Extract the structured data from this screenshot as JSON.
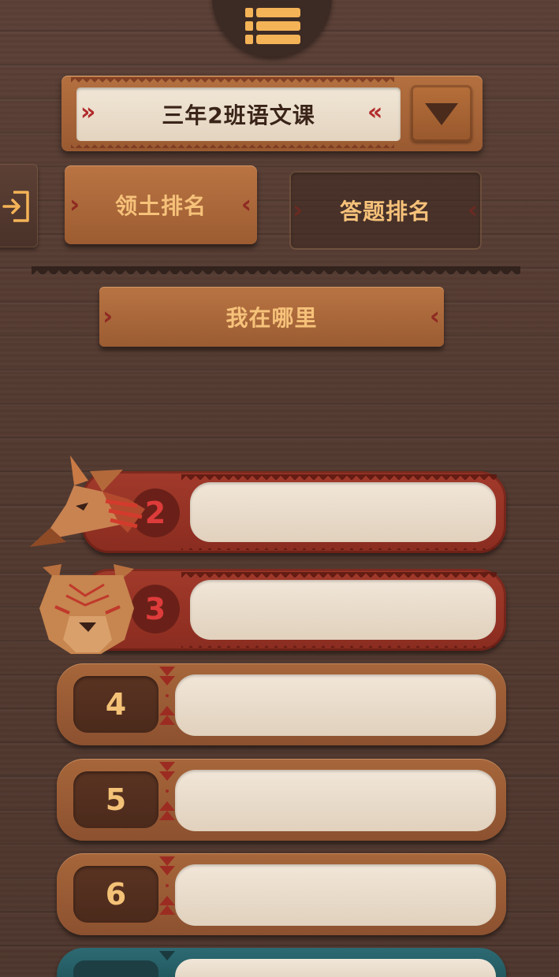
{
  "top_menu": {
    "icon": "menu-list-icon"
  },
  "class_selector": {
    "selected": "三年2班语文课",
    "icon": "dropdown-arrow-icon"
  },
  "exit": {
    "icon": "exit-door-icon"
  },
  "tabs": [
    {
      "label": "领土排名",
      "active": true
    },
    {
      "label": "答题排名",
      "active": false
    }
  ],
  "where_am_i": {
    "label": "我在哪里"
  },
  "rankings": [
    {
      "rank": "2",
      "style": "red",
      "avatar": "wolf-head-icon",
      "name": ""
    },
    {
      "rank": "3",
      "style": "red",
      "avatar": "bear-head-icon",
      "name": ""
    },
    {
      "rank": "4",
      "style": "wood",
      "name": ""
    },
    {
      "rank": "5",
      "style": "wood",
      "name": ""
    },
    {
      "rank": "6",
      "style": "wood",
      "name": ""
    },
    {
      "rank": "",
      "style": "teal",
      "name": ""
    }
  ],
  "colors": {
    "background": "#52392f",
    "button_wood": "#ab673a",
    "button_text": "#f6c27a",
    "accent_red": "#b12b2b",
    "rank_red": "#a23a2b",
    "rank_teal": "#2d6a73"
  }
}
